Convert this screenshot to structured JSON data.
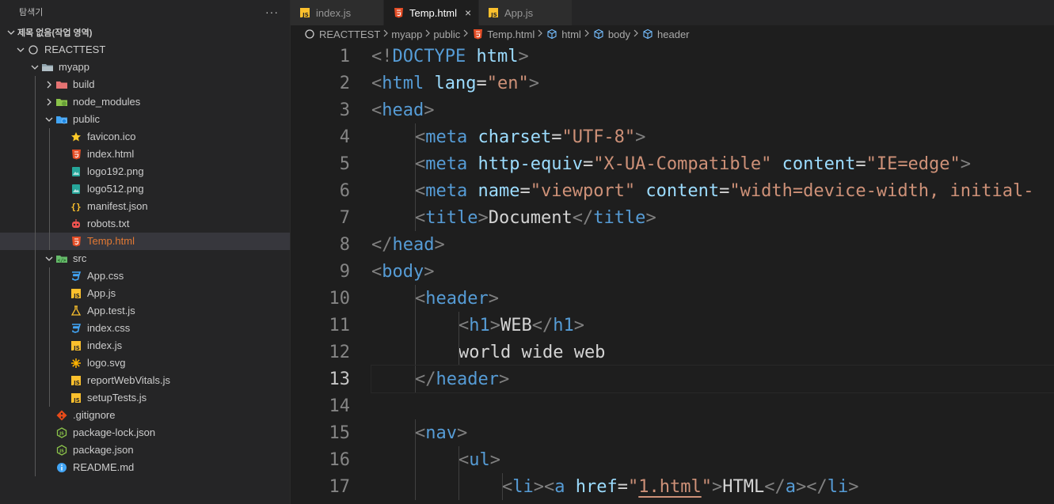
{
  "sidebar": {
    "title": "탐색기",
    "more": "···",
    "workspace": "제목 없음(작업 영역)",
    "tree": [
      {
        "label": "REACTTEST",
        "depth": 0,
        "type": "folder",
        "open": true,
        "icon": "repo-icon"
      },
      {
        "label": "myapp",
        "depth": 1,
        "type": "folder",
        "open": true,
        "icon": "folder-icon"
      },
      {
        "label": "build",
        "depth": 2,
        "type": "folder",
        "open": false,
        "icon": "folder-build-icon"
      },
      {
        "label": "node_modules",
        "depth": 2,
        "type": "folder",
        "open": false,
        "icon": "folder-node-icon"
      },
      {
        "label": "public",
        "depth": 2,
        "type": "folder",
        "open": true,
        "icon": "folder-public-icon"
      },
      {
        "label": "favicon.ico",
        "depth": 3,
        "type": "file",
        "icon": "star-icon"
      },
      {
        "label": "index.html",
        "depth": 3,
        "type": "file",
        "icon": "html5-icon"
      },
      {
        "label": "logo192.png",
        "depth": 3,
        "type": "file",
        "icon": "image-icon"
      },
      {
        "label": "logo512.png",
        "depth": 3,
        "type": "file",
        "icon": "image-icon"
      },
      {
        "label": "manifest.json",
        "depth": 3,
        "type": "file",
        "icon": "json-braces-icon"
      },
      {
        "label": "robots.txt",
        "depth": 3,
        "type": "file",
        "icon": "robot-icon"
      },
      {
        "label": "Temp.html",
        "depth": 3,
        "type": "file",
        "icon": "html5-icon",
        "selected": true,
        "modified": true
      },
      {
        "label": "src",
        "depth": 2,
        "type": "folder",
        "open": true,
        "icon": "folder-src-icon"
      },
      {
        "label": "App.css",
        "depth": 3,
        "type": "file",
        "icon": "css-icon"
      },
      {
        "label": "App.js",
        "depth": 3,
        "type": "file",
        "icon": "js-icon"
      },
      {
        "label": "App.test.js",
        "depth": 3,
        "type": "file",
        "icon": "flask-icon"
      },
      {
        "label": "index.css",
        "depth": 3,
        "type": "file",
        "icon": "css-icon"
      },
      {
        "label": "index.js",
        "depth": 3,
        "type": "file",
        "icon": "js-icon"
      },
      {
        "label": "logo.svg",
        "depth": 3,
        "type": "file",
        "icon": "svg-asterisk-icon"
      },
      {
        "label": "reportWebVitals.js",
        "depth": 3,
        "type": "file",
        "icon": "js-icon"
      },
      {
        "label": "setupTests.js",
        "depth": 3,
        "type": "file",
        "icon": "js-icon"
      },
      {
        "label": ".gitignore",
        "depth": 2,
        "type": "file",
        "icon": "git-icon"
      },
      {
        "label": "package-lock.json",
        "depth": 2,
        "type": "file",
        "icon": "node-icon"
      },
      {
        "label": "package.json",
        "depth": 2,
        "type": "file",
        "icon": "node-icon"
      },
      {
        "label": "README.md",
        "depth": 2,
        "type": "file",
        "icon": "info-icon"
      }
    ]
  },
  "tabs": [
    {
      "label": "index.js",
      "icon": "js-icon",
      "active": false
    },
    {
      "label": "Temp.html",
      "icon": "html5-icon",
      "active": true,
      "close": "×"
    },
    {
      "label": "App.js",
      "icon": "js-icon",
      "active": false
    }
  ],
  "breadcrumb": [
    {
      "label": "REACTTEST",
      "icon": "repo-icon"
    },
    {
      "label": "myapp",
      "icon": ""
    },
    {
      "label": "public",
      "icon": ""
    },
    {
      "label": "Temp.html",
      "icon": "html5-icon"
    },
    {
      "label": "html",
      "icon": "cube-icon"
    },
    {
      "label": "body",
      "icon": "cube-icon"
    },
    {
      "label": "header",
      "icon": "cube-icon"
    }
  ],
  "editor": {
    "current_line": 13,
    "lines": [
      {
        "n": "1",
        "indent": 0,
        "tokens": [
          [
            "br",
            "<!"
          ],
          [
            "tag",
            "DOCTYPE"
          ],
          [
            "txt",
            " "
          ],
          [
            "attr",
            "html"
          ],
          [
            "br",
            ">"
          ]
        ]
      },
      {
        "n": "2",
        "indent": 0,
        "tokens": [
          [
            "br",
            "<"
          ],
          [
            "tag",
            "html"
          ],
          [
            "txt",
            " "
          ],
          [
            "attr",
            "lang"
          ],
          [
            "txt",
            "="
          ],
          [
            "str",
            "\"en\""
          ],
          [
            "br",
            ">"
          ]
        ]
      },
      {
        "n": "3",
        "indent": 0,
        "tokens": [
          [
            "br",
            "<"
          ],
          [
            "tag",
            "head"
          ],
          [
            "br",
            ">"
          ]
        ]
      },
      {
        "n": "4",
        "indent": 1,
        "tokens": [
          [
            "br",
            "<"
          ],
          [
            "tag",
            "meta"
          ],
          [
            "txt",
            " "
          ],
          [
            "attr",
            "charset"
          ],
          [
            "txt",
            "="
          ],
          [
            "str",
            "\"UTF-8\""
          ],
          [
            "br",
            ">"
          ]
        ]
      },
      {
        "n": "5",
        "indent": 1,
        "tokens": [
          [
            "br",
            "<"
          ],
          [
            "tag",
            "meta"
          ],
          [
            "txt",
            " "
          ],
          [
            "attr",
            "http-equiv"
          ],
          [
            "txt",
            "="
          ],
          [
            "str",
            "\"X-UA-Compatible\""
          ],
          [
            "txt",
            " "
          ],
          [
            "attr",
            "content"
          ],
          [
            "txt",
            "="
          ],
          [
            "str",
            "\"IE=edge\""
          ],
          [
            "br",
            ">"
          ]
        ]
      },
      {
        "n": "6",
        "indent": 1,
        "tokens": [
          [
            "br",
            "<"
          ],
          [
            "tag",
            "meta"
          ],
          [
            "txt",
            " "
          ],
          [
            "attr",
            "name"
          ],
          [
            "txt",
            "="
          ],
          [
            "str",
            "\"viewport\""
          ],
          [
            "txt",
            " "
          ],
          [
            "attr",
            "content"
          ],
          [
            "txt",
            "="
          ],
          [
            "str",
            "\"width=device-width, initial-"
          ]
        ]
      },
      {
        "n": "7",
        "indent": 1,
        "tokens": [
          [
            "br",
            "<"
          ],
          [
            "tag",
            "title"
          ],
          [
            "br",
            ">"
          ],
          [
            "txt",
            "Document"
          ],
          [
            "br",
            "</"
          ],
          [
            "tag",
            "title"
          ],
          [
            "br",
            ">"
          ]
        ]
      },
      {
        "n": "8",
        "indent": 0,
        "tokens": [
          [
            "br",
            "</"
          ],
          [
            "tag",
            "head"
          ],
          [
            "br",
            ">"
          ]
        ]
      },
      {
        "n": "9",
        "indent": 0,
        "tokens": [
          [
            "br",
            "<"
          ],
          [
            "tag",
            "body"
          ],
          [
            "br",
            ">"
          ]
        ]
      },
      {
        "n": "10",
        "indent": 1,
        "tokens": [
          [
            "br",
            "<"
          ],
          [
            "tag",
            "header"
          ],
          [
            "br",
            ">"
          ]
        ]
      },
      {
        "n": "11",
        "indent": 2,
        "tokens": [
          [
            "br",
            "<"
          ],
          [
            "tag",
            "h1"
          ],
          [
            "br",
            ">"
          ],
          [
            "txt",
            "WEB"
          ],
          [
            "br",
            "</"
          ],
          [
            "tag",
            "h1"
          ],
          [
            "br",
            ">"
          ]
        ]
      },
      {
        "n": "12",
        "indent": 2,
        "tokens": [
          [
            "txt",
            "world wide web"
          ]
        ]
      },
      {
        "n": "13",
        "indent": 1,
        "tokens": [
          [
            "br",
            "</"
          ],
          [
            "tag",
            "header"
          ],
          [
            "br",
            ">"
          ]
        ]
      },
      {
        "n": "14",
        "indent": 0,
        "tokens": []
      },
      {
        "n": "15",
        "indent": 1,
        "tokens": [
          [
            "br",
            "<"
          ],
          [
            "tag",
            "nav"
          ],
          [
            "br",
            ">"
          ]
        ]
      },
      {
        "n": "16",
        "indent": 2,
        "tokens": [
          [
            "br",
            "<"
          ],
          [
            "tag",
            "ul"
          ],
          [
            "br",
            ">"
          ]
        ]
      },
      {
        "n": "17",
        "indent": 3,
        "tokens": [
          [
            "br",
            "<"
          ],
          [
            "tag",
            "li"
          ],
          [
            "br",
            "><"
          ],
          [
            "tag",
            "a"
          ],
          [
            "txt",
            " "
          ],
          [
            "attr",
            "href"
          ],
          [
            "txt",
            "="
          ],
          [
            "str",
            "\""
          ],
          [
            "strsq",
            "1.html"
          ],
          [
            "str",
            "\""
          ],
          [
            "br",
            ">"
          ],
          [
            "txt",
            "HTML"
          ],
          [
            "br",
            "</"
          ],
          [
            "tag",
            "a"
          ],
          [
            "br",
            "></"
          ],
          [
            "tag",
            "li"
          ],
          [
            "br",
            ">"
          ]
        ]
      }
    ]
  }
}
